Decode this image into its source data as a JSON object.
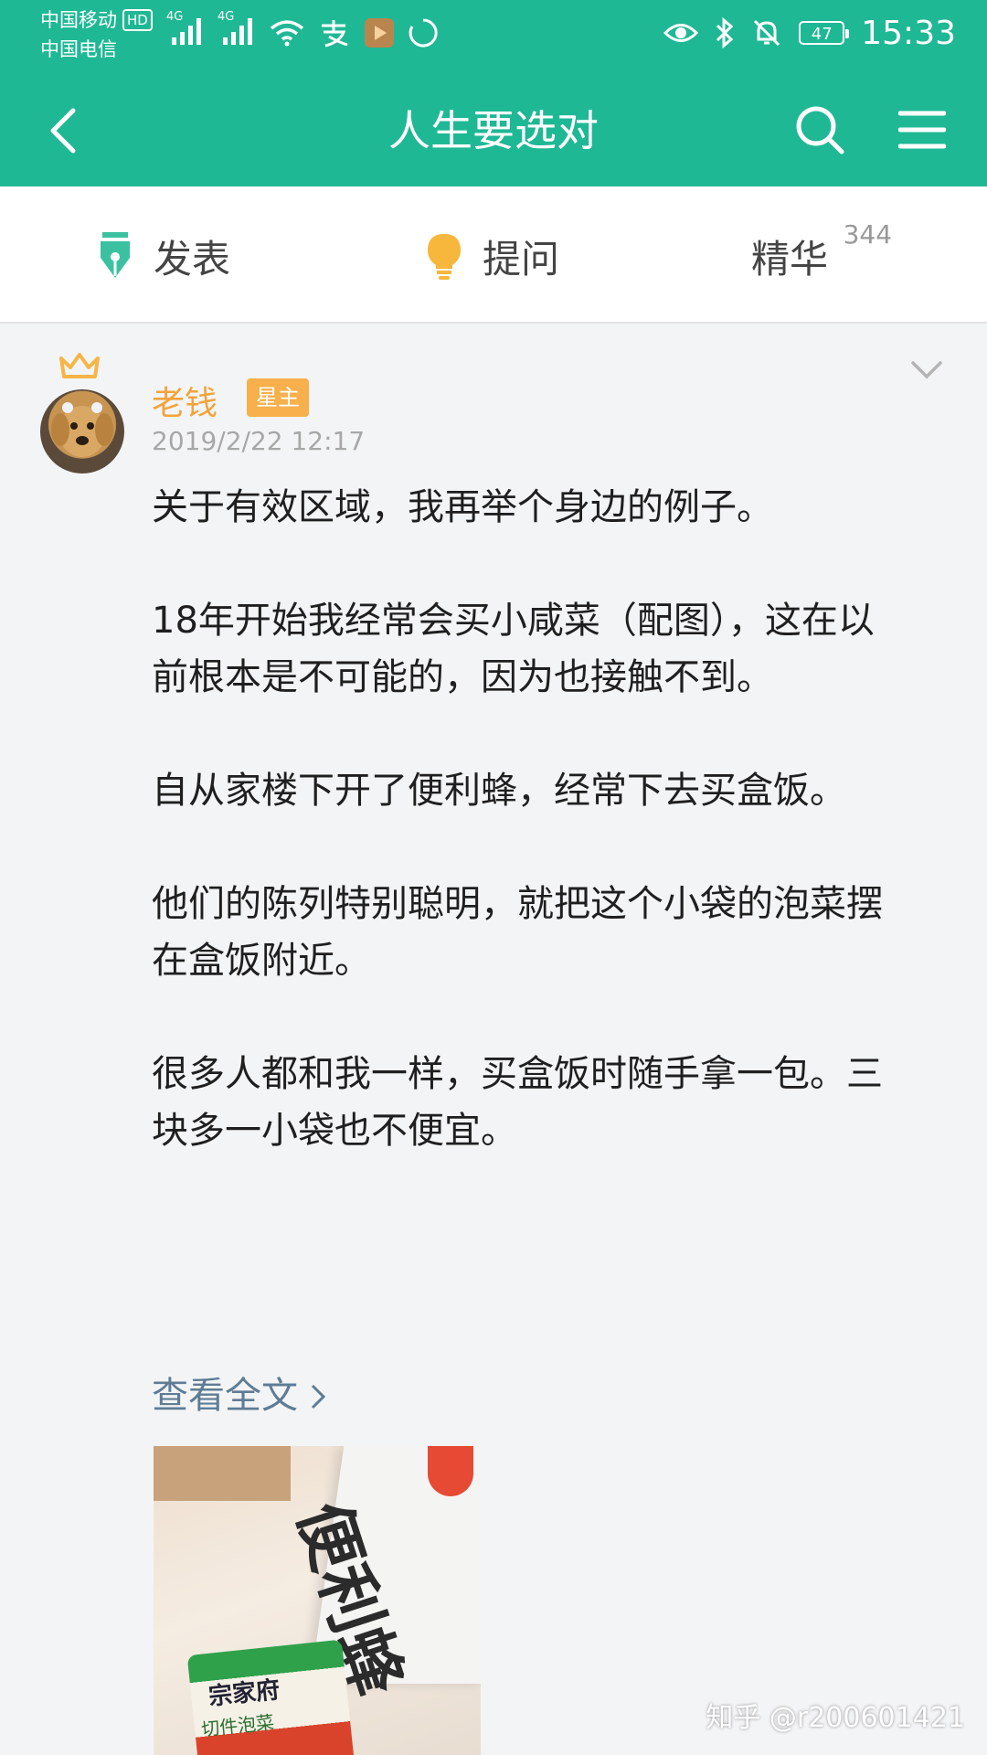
{
  "status_bar": {
    "carrier_1": "中国移动",
    "carrier_1_badge": "HD",
    "carrier_2": "中国电信",
    "network_1": "4G",
    "network_2": "4G",
    "battery_level": "47",
    "time": "15:33"
  },
  "header": {
    "title": "人生要选对",
    "back_icon": "chevron-left-icon",
    "search_icon": "search-icon",
    "menu_icon": "menu-icon",
    "background": "#1fb895"
  },
  "tabs": [
    {
      "label": "发表",
      "icon": "pen-nib-icon",
      "icon_color": "#3bc1a0"
    },
    {
      "label": "提问",
      "icon": "lightbulb-icon",
      "icon_color": "#f7b73c"
    },
    {
      "label": "精华",
      "count": "344"
    }
  ],
  "post": {
    "author": "老钱",
    "role_badge": "星主",
    "timestamp": "2019/2/22 12:17",
    "paragraphs": [
      "关于有效区域，我再举个身边的例子。",
      "18年开始我经常会买小咸菜（配图），这在以前根本是不可能的，因为也接触不到。",
      "自从家楼下开了便利蜂，经常下去买盒饭。",
      "他们的陈列特别聪明，就把这个小袋的泡菜摆在盒饭附近。",
      "很多人都和我一样，买盒饭时随手拿一包。三块多一小袋也不便宜。"
    ],
    "read_more": "查看全文",
    "image": {
      "bag_text": "便利蜂",
      "pack_brand": "宗家府",
      "pack_name": "切件泡菜"
    }
  },
  "watermark": "知乎 @r200601421",
  "colors": {
    "accent": "#1fb895",
    "author": "#f2a33a",
    "link": "#5e7c95"
  }
}
